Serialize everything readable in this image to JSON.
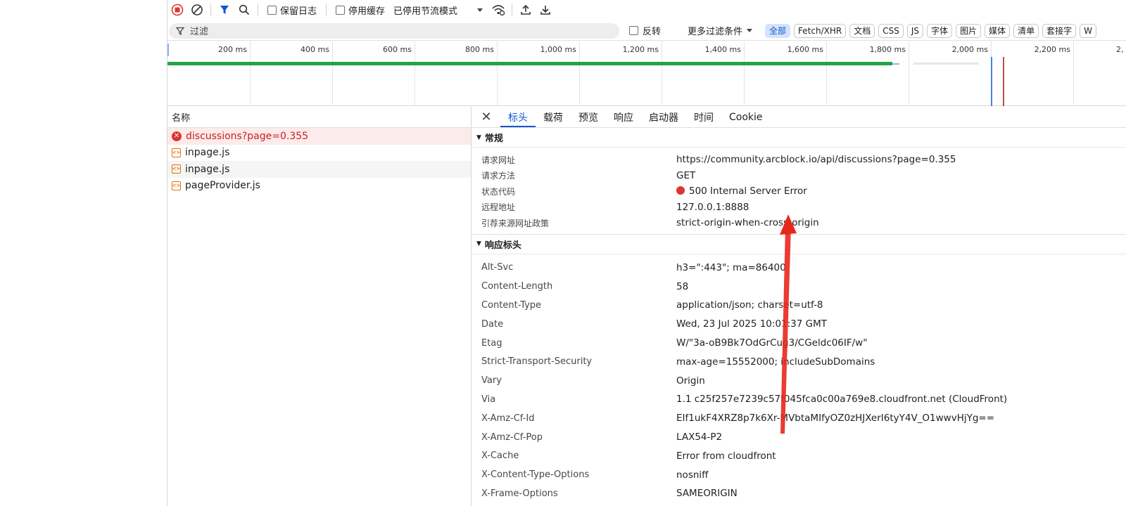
{
  "toolbar": {
    "preserve_log_label": "保留日志",
    "disable_cache_label": "停用缓存",
    "throttling_value": "已停用节流模式"
  },
  "filterbar": {
    "filter_placeholder": "过滤",
    "invert_label": "反转",
    "more_filters_label": "更多过滤条件",
    "chips": [
      "全部",
      "Fetch/XHR",
      "文档",
      "CSS",
      "JS",
      "字体",
      "图片",
      "媒体",
      "清单",
      "套接字",
      "W"
    ]
  },
  "overview": {
    "ticks": [
      "200 ms",
      "400 ms",
      "600 ms",
      "800 ms",
      "1,000 ms",
      "1,200 ms",
      "1,400 ms",
      "1,600 ms",
      "1,800 ms",
      "2,000 ms",
      "2,200 ms",
      "2,"
    ]
  },
  "request_list": {
    "header": "名称",
    "items": [
      {
        "name": "discussions?page=0.355",
        "type": "error"
      },
      {
        "name": "inpage.js",
        "type": "script"
      },
      {
        "name": "inpage.js",
        "type": "script"
      },
      {
        "name": "pageProvider.js",
        "type": "script"
      }
    ]
  },
  "details": {
    "tabs": [
      "标头",
      "载荷",
      "预览",
      "响应",
      "启动器",
      "时间",
      "Cookie"
    ],
    "general": {
      "title": "常规",
      "rows": [
        {
          "k": "请求网址",
          "v": "https://community.arcblock.io/api/discussions?page=0.355"
        },
        {
          "k": "请求方法",
          "v": "GET"
        },
        {
          "k": "状态代码",
          "v": "500 Internal Server Error"
        },
        {
          "k": "远程地址",
          "v": "127.0.0.1:8888"
        },
        {
          "k": "引荐来源网址政策",
          "v": "strict-origin-when-cross-origin"
        }
      ]
    },
    "response_headers": {
      "title": "响应标头",
      "rows": [
        {
          "k": "Alt-Svc",
          "v": "h3=\":443\"; ma=86400"
        },
        {
          "k": "Content-Length",
          "v": "58"
        },
        {
          "k": "Content-Type",
          "v": "application/json; charset=utf-8"
        },
        {
          "k": "Date",
          "v": "Wed, 23 Jul 2025 10:01:37 GMT"
        },
        {
          "k": "Etag",
          "v": "W/\"3a-oB9Bk7OdGrCug3/CGeldc06IF/w\""
        },
        {
          "k": "Strict-Transport-Security",
          "v": "max-age=15552000; includeSubDomains"
        },
        {
          "k": "Vary",
          "v": "Origin"
        },
        {
          "k": "Via",
          "v": "1.1 c25f257e7239c57f045fca0c00a769e8.cloudfront.net (CloudFront)"
        },
        {
          "k": "X-Amz-Cf-Id",
          "v": "EIf1ukF4XRZ8p7k6Xr-MVbtaMIfyOZ0zHJXerI6tyY4V_O1wwvHjYg=="
        },
        {
          "k": "X-Amz-Cf-Pop",
          "v": "LAX54-P2"
        },
        {
          "k": "X-Cache",
          "v": "Error from cloudfront"
        },
        {
          "k": "X-Content-Type-Options",
          "v": "nosniff"
        },
        {
          "k": "X-Frame-Options",
          "v": "SAMEORIGIN"
        }
      ]
    }
  },
  "colors": {
    "accent": "#0b57d0",
    "error": "#dc362e",
    "waterfall_bar": "#22a34a",
    "annotation_arrow": "#e8271c"
  }
}
